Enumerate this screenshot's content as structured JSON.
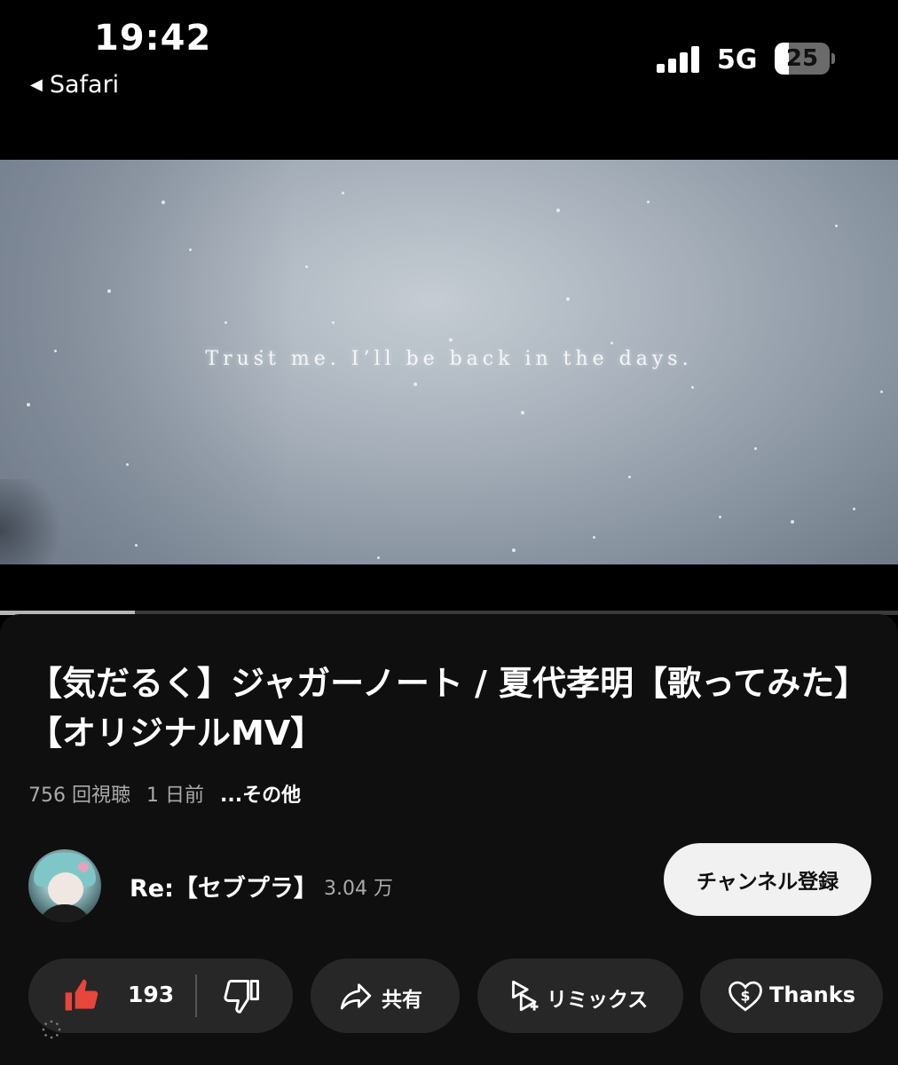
{
  "status_bar": {
    "time": "19:42",
    "back_app": "Safari",
    "network": "5G",
    "battery": "25",
    "battery_level": 0.25
  },
  "video": {
    "caption": "Trust me. I’ll be back in the days.",
    "progress": 0.15
  },
  "details": {
    "title": "【気だるく】ジャガーノート / 夏代孝明【歌ってみた】【オリジナルMV】",
    "views": "756 回視聴",
    "age": "1 日前",
    "more": "...その他"
  },
  "channel": {
    "name": "Re:【セブプラ】",
    "subscribers": "3.04 万",
    "subscribe_label": "チャンネル登録"
  },
  "actions": {
    "like_count": "193",
    "share_label": "共有",
    "remix_label": "リミックス",
    "thanks_label": "Thanks"
  },
  "colors": {
    "like_accent": "#e8453c",
    "pill_bg": "#272727",
    "panel_bg": "#0f0f0f"
  },
  "icons": [
    "back-triangle-icon",
    "signal-icon",
    "battery-icon",
    "like-icon",
    "dislike-icon",
    "share-icon",
    "remix-icon",
    "thanks-icon",
    "loading-icon"
  ]
}
